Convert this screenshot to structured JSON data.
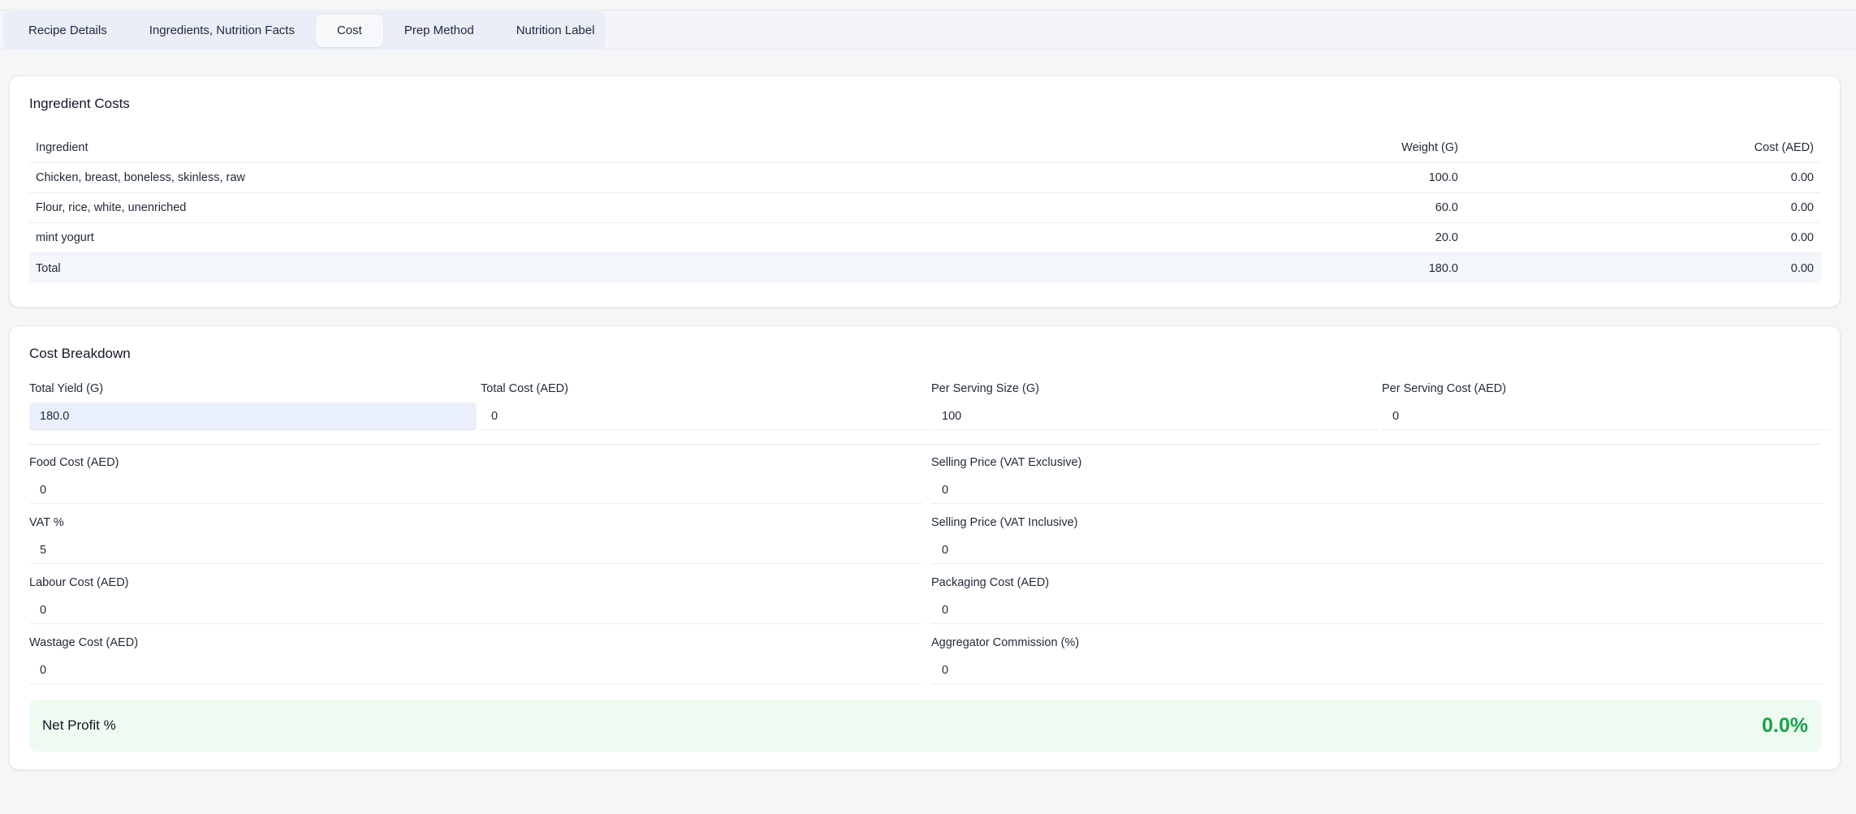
{
  "tabs": [
    {
      "label": "Recipe Details"
    },
    {
      "label": "Ingredients, Nutrition Facts"
    },
    {
      "label": "Cost"
    },
    {
      "label": "Prep Method"
    },
    {
      "label": "Nutrition Label"
    }
  ],
  "active_tab": "Cost",
  "ingredient_costs": {
    "title": "Ingredient Costs",
    "columns": [
      "Ingredient",
      "Weight (G)",
      "Cost (AED)"
    ],
    "rows": [
      {
        "name": "Chicken, breast, boneless, skinless, raw",
        "weight": "100.0",
        "cost": "0.00"
      },
      {
        "name": "Flour, rice, white, unenriched",
        "weight": "60.0",
        "cost": "0.00"
      },
      {
        "name": "mint yogurt",
        "weight": "20.0",
        "cost": "0.00"
      }
    ],
    "total": {
      "name": "Total",
      "weight": "180.0",
      "cost": "0.00"
    }
  },
  "cost_breakdown": {
    "title": "Cost Breakdown",
    "total_yield": {
      "label": "Total Yield (G)",
      "value": "180.0"
    },
    "total_cost": {
      "label": "Total Cost (AED)",
      "value": "0"
    },
    "per_serving_size": {
      "label": "Per Serving Size (G)",
      "value": "100"
    },
    "per_serving_cost": {
      "label": "Per Serving Cost (AED)",
      "value": "0"
    },
    "food_cost": {
      "label": "Food Cost (AED)",
      "value": "0"
    },
    "selling_price_excl": {
      "label": "Selling Price (VAT Exclusive)",
      "value": "0"
    },
    "vat": {
      "label": "VAT %",
      "value": "5"
    },
    "selling_price_incl": {
      "label": "Selling Price (VAT Inclusive)",
      "value": "0"
    },
    "labour_cost": {
      "label": "Labour Cost (AED)",
      "value": "0"
    },
    "packaging_cost": {
      "label": "Packaging Cost (AED)",
      "value": "0"
    },
    "wastage_cost": {
      "label": "Wastage Cost (AED)",
      "value": "0"
    },
    "aggregator_commission": {
      "label": "Aggregator Commission (%)",
      "value": "0"
    },
    "net_profit": {
      "label": "Net Profit %",
      "value": "0.0%"
    }
  },
  "colors": {
    "accent_green": "#16a34a",
    "profit_bg": "#eefbf1",
    "tab_bar_bg": "#e9eef8"
  }
}
